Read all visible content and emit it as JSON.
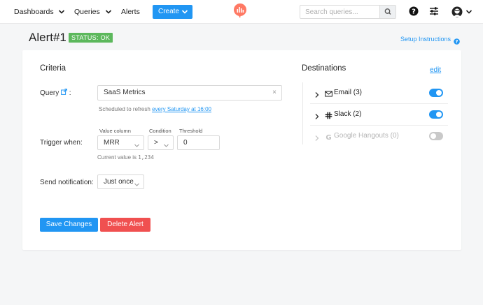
{
  "nav": {
    "dashboards": "Dashboards",
    "queries": "Queries",
    "alerts": "Alerts",
    "create": "Create",
    "search_placeholder": "Search queries..."
  },
  "page": {
    "title": "Alert#1",
    "status": "STATUS: OK",
    "setup_link": "Setup Instructions"
  },
  "criteria": {
    "title": "Criteria",
    "query_label": "Query",
    "query_colon": ":",
    "query_value": "SaaS Metrics",
    "query_clear": "×",
    "schedule_text": "Scheduled to refresh",
    "schedule_link": "every Saturday at 16:00",
    "trigger_label": "Trigger when:",
    "value_column_label": "Value column",
    "value_column": "MRR",
    "condition_label": "Condition",
    "condition": ">",
    "threshold_label": "Threshold",
    "threshold": "0",
    "current_value_text": "Current value is",
    "current_value": "1,234",
    "notify_label": "Send notification:",
    "notify_value": "Just once",
    "save": "Save Changes",
    "delete": "Delete Alert"
  },
  "destinations": {
    "title": "Destinations",
    "edit": "edit",
    "items": [
      {
        "name": "Email (3)",
        "icon": "mail-icon",
        "enabled": true
      },
      {
        "name": "Slack (2)",
        "icon": "slack-icon",
        "enabled": true
      },
      {
        "name": "Google Hangouts (0)",
        "icon": "google-icon",
        "enabled": false
      }
    ]
  },
  "colors": {
    "accent": "#2196f3",
    "status_ok": "#5cb85c",
    "danger": "#f05050",
    "logo": "#ff7964"
  }
}
